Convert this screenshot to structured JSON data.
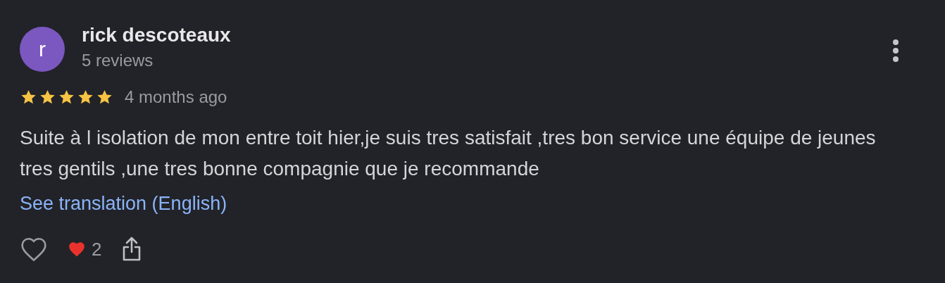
{
  "review": {
    "avatar_letter": "r",
    "author": "rick descoteaux",
    "author_meta": "5 reviews",
    "stars": 5,
    "time": "4 months ago",
    "text": "Suite à l isolation de mon entre toit hier,je suis tres satisfait ,tres bon service une équipe de jeunes tres gentils ,une tres bonne compagnie que je recommande",
    "translate_link": "See translation (English)",
    "liked": false,
    "reaction_count": "2"
  }
}
